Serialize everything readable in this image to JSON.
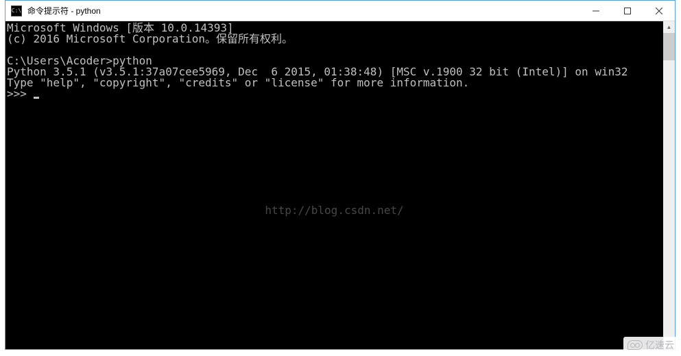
{
  "window": {
    "icon_label": "C:\\",
    "title": "命令提示符 - python"
  },
  "terminal": {
    "line1": "Microsoft Windows [版本 10.0.14393]",
    "line2": "(c) 2016 Microsoft Corporation。保留所有权利。",
    "blank": "",
    "prompt_line": "C:\\Users\\Acoder>python",
    "py_line1": "Python 3.5.1 (v3.5.1:37a07cee5969, Dec  6 2015, 01:38:48) [MSC v.1900 32 bit (Intel)] on win32",
    "py_line2": "Type \"help\", \"copyright\", \"credits\" or \"license\" for more information.",
    "repl_prompt": ">>> "
  },
  "watermark": {
    "center": "http://blog.csdn.net/",
    "corner": "亿速云"
  }
}
